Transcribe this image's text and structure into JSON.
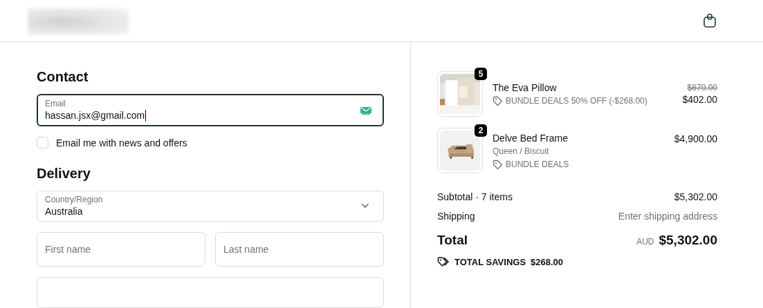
{
  "header": {
    "logo": {
      "kind": "blurred"
    }
  },
  "contact": {
    "title": "Contact",
    "email": {
      "label": "Email",
      "value": "hassan.jsx@gmail.com",
      "focused": true
    },
    "newsletter": {
      "label": "Email me with news and offers",
      "checked": false
    }
  },
  "delivery": {
    "title": "Delivery",
    "country": {
      "label": "Country/Region",
      "value": "Australia"
    },
    "first_name": {
      "placeholder": "First name"
    },
    "last_name": {
      "placeholder": "Last name"
    }
  },
  "order": {
    "items": [
      {
        "name": "The Eva Pillow",
        "quantity": "5",
        "discount": "BUNDLE DEALS 50% OFF (-$268.00)",
        "original_price": "$670.00",
        "price": "$402.00",
        "image": {
          "kind": "pillow"
        }
      },
      {
        "name": "Delve Bed Frame",
        "quantity": "2",
        "variant": "Queen / Biscuit",
        "discount": "BUNDLE DEALS",
        "price": "$4,900.00",
        "image": {
          "kind": "bed"
        }
      }
    ],
    "summary": {
      "subtotal_label": "Subtotal · 7 items",
      "subtotal": "$5,302.00",
      "shipping_label": "Shipping",
      "shipping": "Enter shipping address",
      "total_label": "Total",
      "currency": "AUD",
      "total": "$5,302.00",
      "savings_label": "TOTAL SAVINGS",
      "savings": "$268.00"
    }
  }
}
